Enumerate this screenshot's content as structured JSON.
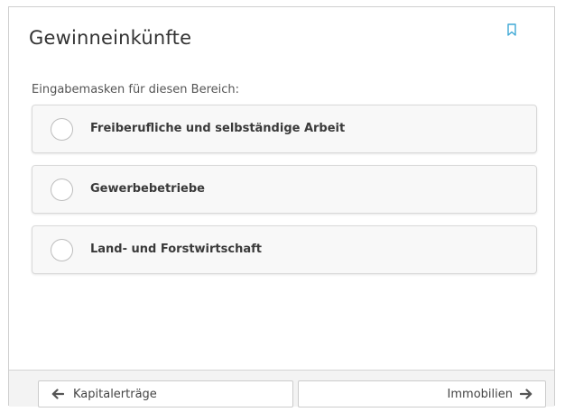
{
  "header": {
    "title": "Gewinneinkünfte",
    "bookmark_icon": "bookmark-icon"
  },
  "section": {
    "subtitle": "Eingabemasken für diesen Bereich:"
  },
  "options": [
    {
      "label": "Freiberufliche und selbständige Arbeit",
      "selected": false
    },
    {
      "label": "Gewerbebetriebe",
      "selected": false
    },
    {
      "label": "Land- und Forstwirtschaft",
      "selected": false
    }
  ],
  "footer": {
    "prev_label": "Kapitalerträge",
    "prev_icon": "arrow-left-icon",
    "next_label": "Immobilien",
    "next_icon": "arrow-right-icon"
  },
  "colors": {
    "accent": "#3fa9d6",
    "border": "#d9d9d9",
    "option_bg": "#f8f8f8"
  }
}
